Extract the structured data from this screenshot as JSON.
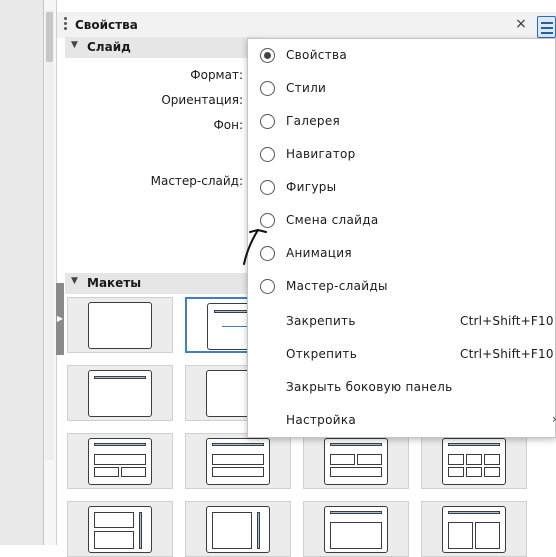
{
  "panel": {
    "title": "Свойства",
    "close_label": "×"
  },
  "slide_section": {
    "title": "Слайд",
    "fields": {
      "format_label": "Формат:",
      "orientation_label": "Ориентация:",
      "background_label": "Фон:",
      "master_label": "Мастер-слайд:"
    }
  },
  "layouts_section": {
    "title": "Макеты"
  },
  "menu": {
    "decks": [
      {
        "label": "Свойства",
        "selected": true
      },
      {
        "label": "Стили",
        "selected": false
      },
      {
        "label": "Галерея",
        "selected": false
      },
      {
        "label": "Навигатор",
        "selected": false
      },
      {
        "label": "Фигуры",
        "selected": false
      },
      {
        "label": "Смена слайда",
        "selected": false
      },
      {
        "label": "Анимация",
        "selected": false
      },
      {
        "label": "Мастер-слайды",
        "selected": false
      }
    ],
    "actions": [
      {
        "label": "Закрепить",
        "shortcut": "Ctrl+Shift+F10"
      },
      {
        "label": "Открепить",
        "shortcut": "Ctrl+Shift+F10"
      },
      {
        "label": "Закрыть боковую панель",
        "shortcut": ""
      },
      {
        "label": "Настройка",
        "shortcut": "",
        "submenu_icon": "›"
      }
    ]
  },
  "icons": {
    "section_arrow": "▼",
    "grip_arrow": "▶"
  },
  "colors": {
    "selection_accent": "#3b7fd0",
    "placeholder_line": "#9ec1e6"
  }
}
